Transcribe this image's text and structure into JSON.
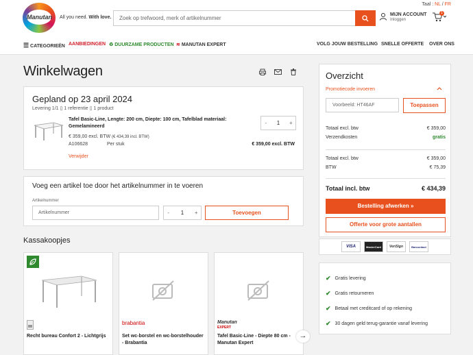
{
  "header": {
    "lang_label": "Taal : ",
    "lang_nl": "NL",
    "lang_sep": " / ",
    "lang_fr": "FR",
    "logo_text": "Manutan",
    "tagline_normal": "All you need. ",
    "tagline_bold": "With love.",
    "search_placeholder": "Zoek op trefwoord, merk of artikelnummer",
    "account_label": "MIJN ACCOUNT",
    "account_sub": "Inloggen",
    "cart_count": "1"
  },
  "nav": {
    "categories": "CATEGORIEËN",
    "offers": "AANBIEDINGEN",
    "sustainable": "DUURZAME PRODUCTEN",
    "expert": "MANUTAN EXPERT",
    "track_order": "VOLG JOUW BESTELLING",
    "quick_quote": "SNELLE OFFERTE",
    "about": "OVER ONS"
  },
  "page_title": "Winkelwagen",
  "delivery": {
    "title": "Gepland op 23 april 2024",
    "meta": "Levering 1/1  ▯ 1 referentie  ▯ 1 product",
    "product_name": "Tafel Basic-Line, Lengte: 200 cm, Diepte: 100 cm, Tafelblad materiaal: Gemelamineerd",
    "price": "€ 359,00  excl. BTW ",
    "price_incl": "(€ 434,39 incl. BTW)",
    "ref": "A106628",
    "unit": "Per stuk",
    "line_total": "€ 359,00  excl. BTW",
    "remove": "Verwijder",
    "qty": "1",
    "minus": "-",
    "plus": "+"
  },
  "add_article": {
    "title": "Voeg een artikel toe door het artikelnummer in te voeren",
    "label": "Artikelnummer",
    "placeholder": "Artikelnummer",
    "qty": "1",
    "minus": "-",
    "plus": "+",
    "button": "Toevoegen"
  },
  "cash_deals": {
    "title": "Kassakoopjes",
    "items": [
      {
        "name": "Recht bureau Confort 2 - Lichtgrijs",
        "brand": ""
      },
      {
        "name": "Set wc-borstel en wc-borstelhouder - Brabantia",
        "brand": "brabantia"
      },
      {
        "name": "Tafel Basic-Line - Diepte 80 cm - Manutan Expert",
        "brand": "Manutan"
      }
    ],
    "expert_sub": "EXPERT",
    "next": "→"
  },
  "summary": {
    "title": "Overzicht",
    "promo_label": "Promotiecode invoeren",
    "promo_placeholder": "Voorbeeld: HT46AF",
    "apply": "Toepassen",
    "rows": [
      {
        "label": "Totaal excl. btw",
        "value": "€ 359,00"
      },
      {
        "label": "Verzendkosten",
        "value": "gratis"
      },
      {
        "label": "Totaal excl. btw",
        "value": "€ 359,00"
      },
      {
        "label": "BTW",
        "value": "€ 75,39"
      }
    ],
    "total_label": "Totaal incl. btw",
    "total_value": "€ 434,39",
    "checkout": "Bestelling afwerken »",
    "quote": "Offerte voor grote aantallen"
  },
  "payment": {
    "visa": "VISA",
    "mastercard": "MasterCard",
    "verisign": "VeriSign",
    "bancontact": "Bancontact"
  },
  "usps": [
    "Gratis levering",
    "Gratis retourneren",
    "Betaal met creditcard of op rekening",
    "30 dagen geld terug-garantie vanaf levering"
  ],
  "colors": {
    "accent": "#e8501d",
    "green": "#2f8a2f",
    "red": "#d0202a"
  }
}
